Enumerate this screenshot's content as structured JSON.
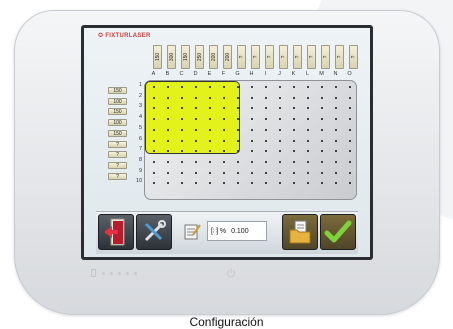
{
  "brand": {
    "name": "FIXTURLASER"
  },
  "column_values": [
    "150",
    "300",
    "150",
    "250",
    "200",
    "200",
    "?",
    "?",
    "?",
    "?",
    "?",
    "?",
    "?",
    "?",
    "?"
  ],
  "column_letters": [
    "A",
    "B",
    "C",
    "D",
    "E",
    "F",
    "G",
    "H",
    "I",
    "J",
    "K",
    "L",
    "M",
    "N",
    "O"
  ],
  "row_numbers": [
    "1",
    "2",
    "3",
    "4",
    "5",
    "6",
    "7",
    "8",
    "9",
    "10"
  ],
  "row_values": [
    "150",
    "100",
    "150",
    "100",
    "150",
    "?",
    "?",
    "?",
    "?"
  ],
  "grid": {
    "selected_columns": 7,
    "selected_rows": 6,
    "selection_color": "#e3f21a"
  },
  "toolbar": {
    "exit_icon": "exit-door-icon",
    "tools_icon": "wrench-screwdriver-icon",
    "edit_icon": "edit-note-icon",
    "spacing_symbol": "[∷]",
    "percent_symbol": "%",
    "value": "0.100",
    "file_icon": "folder-document-icon",
    "confirm_icon": "checkmark-icon"
  },
  "caption": "Configuración"
}
